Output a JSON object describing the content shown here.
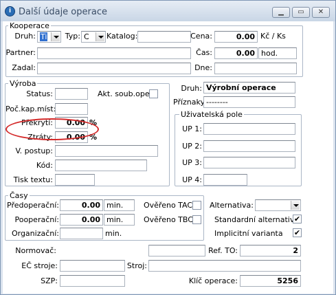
{
  "window": {
    "title": "Další údaje operace",
    "app_icon": "info-icon",
    "buttons": [
      "minimize-icon",
      "maximize-icon",
      "close-icon"
    ]
  },
  "kooperace": {
    "title": "Kooperace",
    "druh_label": "Druh:",
    "druh_value": "Ti",
    "typ_label": "Typ:",
    "typ_value": "C",
    "katalog_label": "Katalog:",
    "katalog_value": "",
    "cena_label": "Cena:",
    "cena_value": "0.00",
    "cena_unit": "Kč / Ks",
    "partner_label": "Partner:",
    "partner_value": "",
    "cas_label": "Čas:",
    "cas_value": "0.00",
    "cas_unit": "hod.",
    "zadal_label": "Zadal:",
    "zadal_value": "",
    "dne_label": "Dne:",
    "dne_value": ""
  },
  "vyroba": {
    "title": "Výroba",
    "status_label": "Status:",
    "status_value": "",
    "akt_label": "Akt. soub.oper.",
    "akt_checked": false,
    "pockap_label": "Poč.kap.míst:",
    "pockap_value": "",
    "prekryti_label": "Překrytí:",
    "prekryti_value": "0.00",
    "prekryti_unit": "%",
    "ztraty_label": "Ztráty:",
    "ztraty_value": "0.00",
    "ztraty_unit": "%",
    "vpostup_label": "V. postup:",
    "vpostup_value": "",
    "kod_label": "Kód:",
    "kod_value": "",
    "tisk_label": "Tisk textu:",
    "tisk_value": ""
  },
  "right": {
    "druh_label": "Druh:",
    "druh_value": "Výrobní operace",
    "priznaky_label": "Příznaky:",
    "priznaky_value": "--------",
    "up_title": "Uživatelská pole",
    "up1_label": "UP 1:",
    "up2_label": "UP 2:",
    "up3_label": "UP 3:",
    "up4_label": "UP 4:"
  },
  "casy": {
    "title": "Časy",
    "pred_label": "Předoperační:",
    "pred_value": "0.00",
    "pred_unit": "min.",
    "poop_label": "Pooperační:",
    "poop_value": "0.00",
    "poop_unit": "min.",
    "org_label": "Organizační:",
    "org_value": "",
    "org_unit": "min.",
    "tac_label": "Ověřeno TAC",
    "tac_checked": false,
    "tbc_label": "Ověřeno TBC",
    "tbc_checked": false
  },
  "alt": {
    "alternativa_label": "Alternativa:",
    "alternativa_value": "",
    "standard_label": "Standardní alternativa",
    "standard_checked": true,
    "implicit_label": "Implicitní varianta",
    "implicit_checked": true
  },
  "bottom": {
    "normovac_label": "Normovač:",
    "normovac_value": "",
    "refto_label": "Ref. TO:",
    "refto_value": "2",
    "ec_label": "EČ stroje:",
    "ec_value": "",
    "stroj_label": "Stroj:",
    "stroj_value": "",
    "szp_label": "SZP:",
    "szp_value": "",
    "klic_label": "Klíč operace:",
    "klic_value": "5256"
  },
  "annotation": {
    "highlight_color": "#d42a2a"
  },
  "check_mark": "✔"
}
